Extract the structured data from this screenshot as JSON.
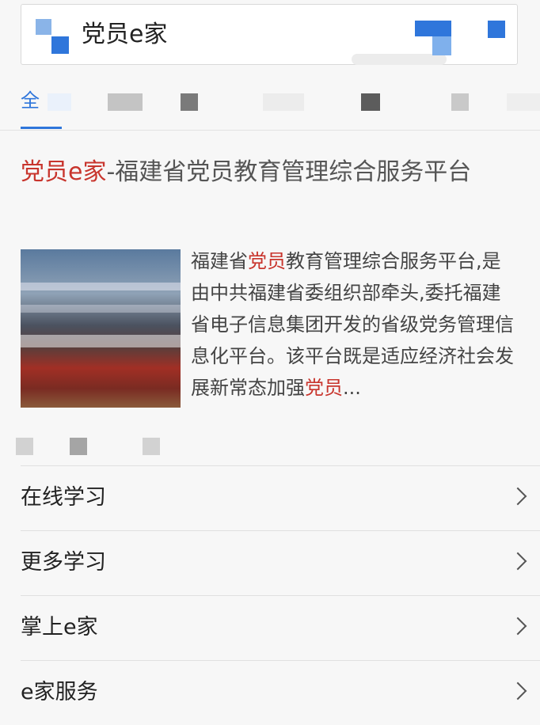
{
  "search": {
    "query": "党员e家",
    "logo_icon": "search-engine-logo-icon",
    "accent_color": "#2f76db"
  },
  "tabs": {
    "active_label": "全"
  },
  "result": {
    "title_highlight": "党员e家",
    "title_rest": "-福建省党员教育管理综合服务平台",
    "thumbnail_icon": "meeting-photo-thumbnail",
    "snippet_parts": [
      "福建省",
      "党员",
      "教育管理综合服务平台,是由中共福建省委组织部牵头,委托福建省电子信息集团开发的省级党务管理信息化平台。该平台既是适应经济社会发展新常态加强",
      "党员",
      "..."
    ],
    "highlight_color": "#c8352d"
  },
  "sitelinks": [
    {
      "label": "在线学习",
      "icon": "chevron-right-icon"
    },
    {
      "label": "更多学习",
      "icon": "chevron-right-icon"
    },
    {
      "label": "掌上e家",
      "icon": "chevron-right-icon"
    },
    {
      "label": "e家服务",
      "icon": "chevron-right-icon"
    }
  ]
}
